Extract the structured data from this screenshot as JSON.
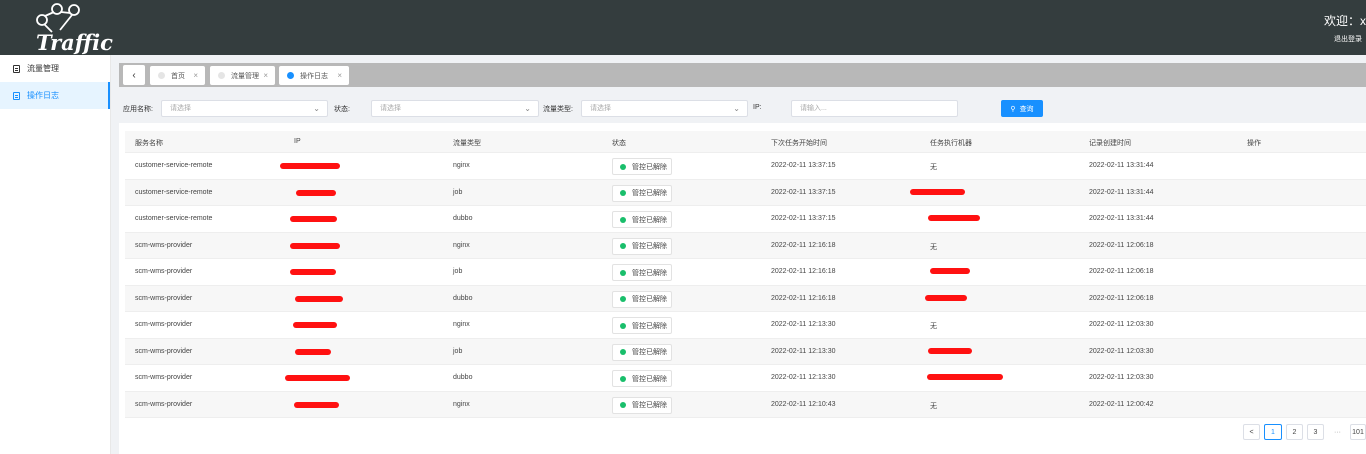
{
  "header": {
    "logo_text": "Traffic",
    "welcome": "欢迎：x",
    "logout": "退出登录"
  },
  "sidebar": {
    "items": [
      {
        "label": "流量管理",
        "active": false
      },
      {
        "label": "操作日志",
        "active": true
      }
    ]
  },
  "tabs": [
    {
      "label": "首页",
      "active": false
    },
    {
      "label": "流量管理",
      "active": false
    },
    {
      "label": "操作日志",
      "active": true
    }
  ],
  "filters": {
    "app_label": "应用名称:",
    "app_placeholder": "请选择",
    "status_label": "状态:",
    "status_placeholder": "请选择",
    "traffic_label": "流量类型:",
    "traffic_placeholder": "请选择",
    "ip_label": "IP:",
    "ip_placeholder": "请输入...",
    "query_label": "查询"
  },
  "table": {
    "columns": [
      "服务名称",
      "IP",
      "流量类型",
      "状态",
      "下次任务开始时间",
      "任务执行机器",
      "记录创建时间",
      "操作"
    ],
    "rows": [
      {
        "service": "customer-service-remote",
        "type": "nginx",
        "status": "管控已解除",
        "next_time": "2022-02-11 13:37:15",
        "machine": "无",
        "created": "2022-02-11 13:31:44"
      },
      {
        "service": "customer-service-remote",
        "type": "job",
        "status": "管控已解除",
        "next_time": "2022-02-11 13:37:15",
        "machine": "",
        "created": "2022-02-11 13:31:44"
      },
      {
        "service": "customer-service-remote",
        "type": "dubbo",
        "status": "管控已解除",
        "next_time": "2022-02-11 13:37:15",
        "machine": "",
        "created": "2022-02-11 13:31:44"
      },
      {
        "service": "scm-wms-provider",
        "type": "nginx",
        "status": "管控已解除",
        "next_time": "2022-02-11 12:16:18",
        "machine": "无",
        "created": "2022-02-11 12:06:18"
      },
      {
        "service": "scm-wms-provider",
        "type": "job",
        "status": "管控已解除",
        "next_time": "2022-02-11 12:16:18",
        "machine": "",
        "created": "2022-02-11 12:06:18"
      },
      {
        "service": "scm-wms-provider",
        "type": "dubbo",
        "status": "管控已解除",
        "next_time": "2022-02-11 12:16:18",
        "machine": "",
        "created": "2022-02-11 12:06:18"
      },
      {
        "service": "scm-wms-provider",
        "type": "nginx",
        "status": "管控已解除",
        "next_time": "2022-02-11 12:13:30",
        "machine": "无",
        "created": "2022-02-11 12:03:30"
      },
      {
        "service": "scm-wms-provider",
        "type": "job",
        "status": "管控已解除",
        "next_time": "2022-02-11 12:13:30",
        "machine": "",
        "created": "2022-02-11 12:03:30"
      },
      {
        "service": "scm-wms-provider",
        "type": "dubbo",
        "status": "管控已解除",
        "next_time": "2022-02-11 12:13:30",
        "machine": "",
        "created": "2022-02-11 12:03:30"
      },
      {
        "service": "scm-wms-provider",
        "type": "nginx",
        "status": "管控已解除",
        "next_time": "2022-02-11 12:10:43",
        "machine": "无",
        "created": "2022-02-11 12:00:42"
      }
    ]
  },
  "pagination": {
    "prev": "<",
    "pages": [
      "1",
      "2",
      "3"
    ],
    "ellipsis": "···",
    "last": "101",
    "current": "1"
  },
  "colors": {
    "header_bg": "#343d3e",
    "accent": "#1890ff",
    "status_dot": "#19be6b",
    "redaction": "#ff1111"
  }
}
